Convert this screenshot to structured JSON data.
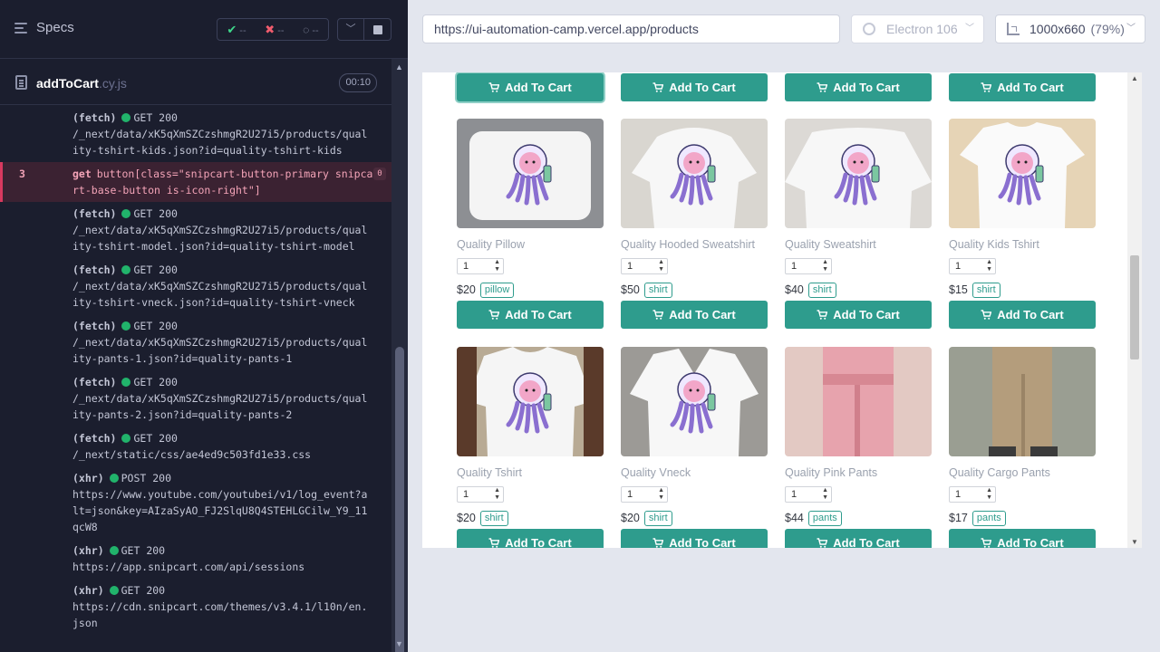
{
  "reporter": {
    "specs_label": "Specs",
    "stats": {
      "passed": "--",
      "failed": "--",
      "pending": "--"
    },
    "file": {
      "name": "addToCart",
      "ext": ".cy.js",
      "duration": "00:10"
    },
    "log": [
      {
        "kind": "request",
        "type": "(fetch)",
        "status": "GET 200",
        "url": "/_next/data/xK5qXmSZCzshmgR2U27i5/products/quality-tshirt-kids.json?id=quality-tshirt-kids"
      },
      {
        "kind": "command",
        "number": "3",
        "name": "get",
        "message": "button[class=\"snipcart-button-primary snipcart-base-button is-icon-right\"]",
        "badge": "0"
      },
      {
        "kind": "request",
        "type": "(fetch)",
        "status": "GET 200",
        "url": "/_next/data/xK5qXmSZCzshmgR2U27i5/products/quality-tshirt-model.json?id=quality-tshirt-model"
      },
      {
        "kind": "request",
        "type": "(fetch)",
        "status": "GET 200",
        "url": "/_next/data/xK5qXmSZCzshmgR2U27i5/products/quality-tshirt-vneck.json?id=quality-tshirt-vneck"
      },
      {
        "kind": "request",
        "type": "(fetch)",
        "status": "GET 200",
        "url": "/_next/data/xK5qXmSZCzshmgR2U27i5/products/quality-pants-1.json?id=quality-pants-1"
      },
      {
        "kind": "request",
        "type": "(fetch)",
        "status": "GET 200",
        "url": "/_next/data/xK5qXmSZCzshmgR2U27i5/products/quality-pants-2.json?id=quality-pants-2"
      },
      {
        "kind": "request",
        "type": "(fetch)",
        "status": "GET 200",
        "url": "/_next/static/css/ae4ed9c503fd1e33.css"
      },
      {
        "kind": "request",
        "type": "(xhr)",
        "status": "POST 200",
        "url": "https://www.youtube.com/youtubei/v1/log_event?alt=json&key=AIzaSyAO_FJ2SlqU8Q4STEHLGCilw_Y9_11qcW8"
      },
      {
        "kind": "request",
        "type": "(xhr)",
        "status": "GET 200",
        "url": "https://app.snipcart.com/api/sessions"
      },
      {
        "kind": "request",
        "type": "(xhr)",
        "status": "GET 200",
        "url": "https://cdn.snipcart.com/themes/v3.4.1/l10n/en.json"
      }
    ]
  },
  "browser": {
    "url": "https://ui-automation-camp.vercel.app/products",
    "engine": "Electron 106",
    "viewport": "1000x660",
    "scale": "(79%)"
  },
  "shop": {
    "cart_label": "Add To Cart",
    "products": [
      {
        "name": "Quality Pillow",
        "qty": "1",
        "price": "$20",
        "tag": "pillow",
        "image": "pillow",
        "bg": "#8d8f93"
      },
      {
        "name": "Quality Hooded Sweatshirt",
        "qty": "1",
        "price": "$50",
        "tag": "shirt",
        "image": "hoodie",
        "bg": "#d9d6d0"
      },
      {
        "name": "Quality Sweatshirt",
        "qty": "1",
        "price": "$40",
        "tag": "shirt",
        "image": "sweatshirt",
        "bg": "#dcd9d5"
      },
      {
        "name": "Quality Kids Tshirt",
        "qty": "1",
        "price": "$15",
        "tag": "shirt",
        "image": "kids-tshirt",
        "bg": "#e6d4b6"
      },
      {
        "name": "Quality Tshirt",
        "qty": "1",
        "price": "$20",
        "tag": "shirt",
        "image": "tshirt",
        "bg": "#b8aa94"
      },
      {
        "name": "Quality Vneck",
        "qty": "1",
        "price": "$20",
        "tag": "shirt",
        "image": "vneck",
        "bg": "#9c9a96"
      },
      {
        "name": "Quality Pink Pants",
        "qty": "1",
        "price": "$44",
        "tag": "pants",
        "image": "pink-pants",
        "bg": "#e3c9c3"
      },
      {
        "name": "Quality Cargo Pants",
        "qty": "1",
        "price": "$17",
        "tag": "pants",
        "image": "cargo-pants",
        "bg": "#9a9e92"
      }
    ]
  }
}
